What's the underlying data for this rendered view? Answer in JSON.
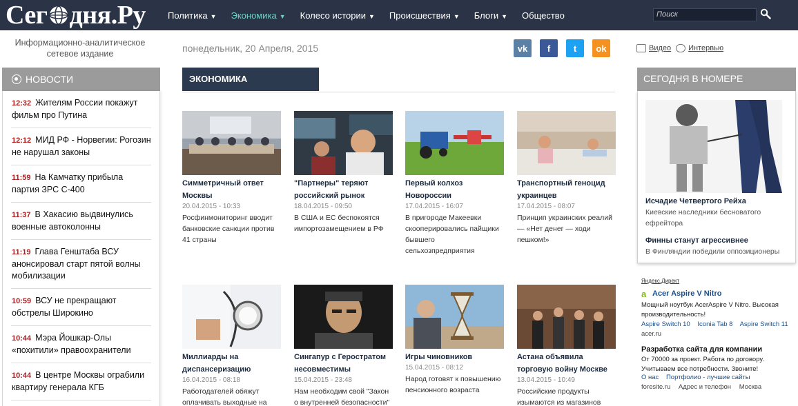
{
  "site": {
    "logo_text_1": "Сег",
    "logo_text_2": "дня.Ру",
    "tagline": "Информационно-аналитическое сетевое издание"
  },
  "nav": {
    "items": [
      {
        "label": "Политика",
        "caret": "▼"
      },
      {
        "label": "Экономика",
        "caret": "▼"
      },
      {
        "label": "Колесо истории",
        "caret": "▼"
      },
      {
        "label": "Происшествия",
        "caret": "▼"
      },
      {
        "label": "Блоги",
        "caret": "▼"
      },
      {
        "label": "Общество",
        "caret": ""
      }
    ],
    "search_placeholder": "Поиск"
  },
  "colors": {
    "topbar": "#2b3446",
    "active_nav": "#6fd0c6",
    "section_tab": "#2c3a4f",
    "news_time": "#b02020",
    "vk": "#5b80a6",
    "fb": "#3b5998",
    "tw": "#1da1f2",
    "ok": "#f5911e"
  },
  "news": {
    "header": "НОВОСТИ",
    "items": [
      {
        "time": "12:32",
        "text": "Жителям России покажут фильм про Путина"
      },
      {
        "time": "12:12",
        "text": "МИД РФ - Норвегии: Рогозин не нарушал законы"
      },
      {
        "time": "11:59",
        "text": "На Камчатку прибыла партия ЗРС С-400"
      },
      {
        "time": "11:37",
        "text": "В Хакасию выдвинулись военные автоколонны"
      },
      {
        "time": "11:19",
        "text": "Глава Генштаба ВСУ анонсировал старт пятой волны мобилизации"
      },
      {
        "time": "10:59",
        "text": "ВСУ не прекращают обстрелы Широкино"
      },
      {
        "time": "10:44",
        "text": "Мэра Йошкар-Олы «похитили» правоохранители"
      },
      {
        "time": "10:44",
        "text": "В центре Москвы ограбили квартиру генерала КГБ"
      }
    ]
  },
  "center": {
    "date": "понедельник, 20 Апреля, 2015",
    "social": {
      "vk": "vk",
      "fb": "f",
      "tw": "t",
      "ok": "ok"
    },
    "section": "ЭКОНОМИКА",
    "cards": [
      {
        "title": "Симметричный ответ Москвы",
        "date": "20.04.2015 - 10:33",
        "desc": "Росфинмониторинг вводит банковские санкции против 41 страны",
        "image": "meeting-photo"
      },
      {
        "title": "\"Партнеры\" теряют российский рынок",
        "date": "18.04.2015 - 09:50",
        "desc": "В США и ЕС беспокоятся импортозамещением в РФ",
        "image": "trader-photo"
      },
      {
        "title": "Первый колхоз Новороссии",
        "date": "17.04.2015 - 16:07",
        "desc": "В пригороде Макеевки скооперировались пайщики бывшего сельхозпредприятия",
        "image": "tractor-photo"
      },
      {
        "title": "Транспортный геноцид украинцев",
        "date": "17.04.2015 - 08:07",
        "desc": "Принцип украинских реалий — «Нет денег — ходи пешком!»",
        "image": "train-photo"
      },
      {
        "title": "Миллиарды на диспансеризацию",
        "date": "16.04.2015 - 08:18",
        "desc": "Работодателей обяжут оплачивать выходные на",
        "image": "doctor-photo"
      },
      {
        "title": "Сингапур с Геростратом несовместимы",
        "date": "15.04.2015 - 23:48",
        "desc": "Нам необходим свой \"Закон о внутренней безопасности\"",
        "image": "portrait-photo"
      },
      {
        "title": "Игры чиновников",
        "date": "15.04.2015 - 08:12",
        "desc": "Народ готовят к повышению пенсионного возраста",
        "image": "hourglass-photo"
      },
      {
        "title": "Астана объявила торговую войну Москве",
        "date": "13.04.2015 - 10:49",
        "desc": "Российские продукты изымаются из магазинов",
        "image": "press-photo"
      }
    ]
  },
  "right": {
    "video": "Видео",
    "interview": "Интервью",
    "today_header": "СЕГОДНЯ В НОМЕРЕ",
    "today_image": "caricature-illustration",
    "today_items": [
      {
        "title": "Исчадие Четвертого Рейха",
        "desc": "Киевские наследники бесноватого ефрейтора"
      },
      {
        "title": "Финны станут агрессивнее",
        "desc": "В Финляндии победили оппозиционеры"
      }
    ],
    "ads": {
      "label": "Яндекс.Директ",
      "ad1": {
        "title": "Acer Aspire V Nitro",
        "text": "Мощный ноутбук AcerAspire V Nitro. Высокая производительность!",
        "links": [
          "Aspire Switch 10",
          "Iconia Tab 8",
          "Aspire Switch 11"
        ],
        "domain": "acer.ru"
      },
      "ad2": {
        "title": "Разработка сайта для компании",
        "text": "От 70000 за проект. Работа по договору. Учитываем все потребности. Звоните!",
        "links": [
          "О нас",
          "Портфолио - лучшие сайты"
        ],
        "domain": [
          "foresite.ru",
          "Адрес и телефон",
          "Москва"
        ]
      }
    }
  }
}
